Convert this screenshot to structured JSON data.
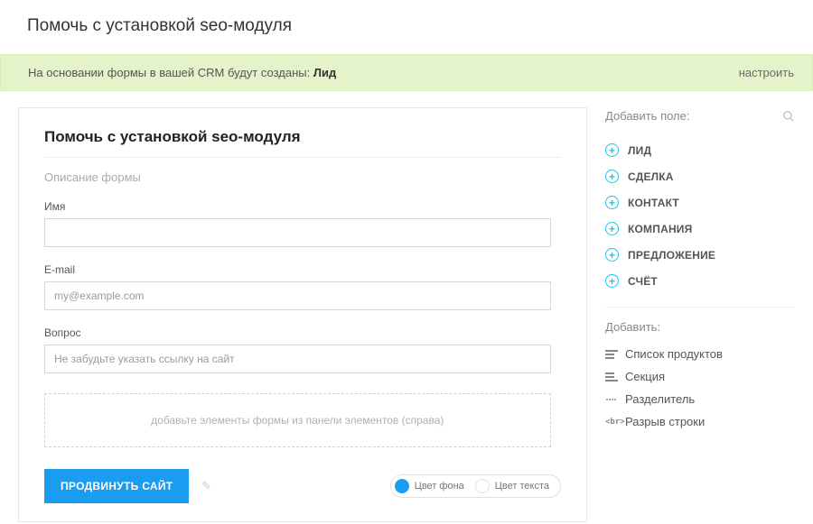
{
  "header": {
    "title": "Помочь с установкой seo-модуля"
  },
  "notice": {
    "prefix": "На основании формы в вашей CRM будут созданы: ",
    "entity": "Лид",
    "configure": "настроить"
  },
  "form": {
    "title": "Помочь с установкой seo-модуля",
    "description_placeholder": "Описание формы",
    "fields": [
      {
        "label": "Имя",
        "value": "",
        "placeholder": ""
      },
      {
        "label": "E-mail",
        "value": "",
        "placeholder": "my@example.com"
      },
      {
        "label": "Вопрос",
        "value": "",
        "placeholder": "Не забудьте указать ссылку на сайт"
      }
    ],
    "dropzone": "добавьте элементы формы из панели элементов (справа)",
    "submit": "ПРОДВИНУТЬ САЙТ",
    "color_bg": "Цвет фона",
    "color_txt": "Цвет текста"
  },
  "side": {
    "search_label": "Добавить поле:",
    "categories": [
      "ЛИД",
      "СДЕЛКА",
      "КОНТАКТ",
      "КОМПАНИЯ",
      "ПРЕДЛОЖЕНИЕ",
      "СЧЁТ"
    ],
    "add_label": "Добавить:",
    "elements": [
      {
        "icon": "list",
        "label": "Список продуктов"
      },
      {
        "icon": "section",
        "label": "Секция"
      },
      {
        "icon": "divider",
        "label": "Разделитель"
      },
      {
        "icon": "br",
        "label": "Разрыв строки"
      }
    ]
  }
}
